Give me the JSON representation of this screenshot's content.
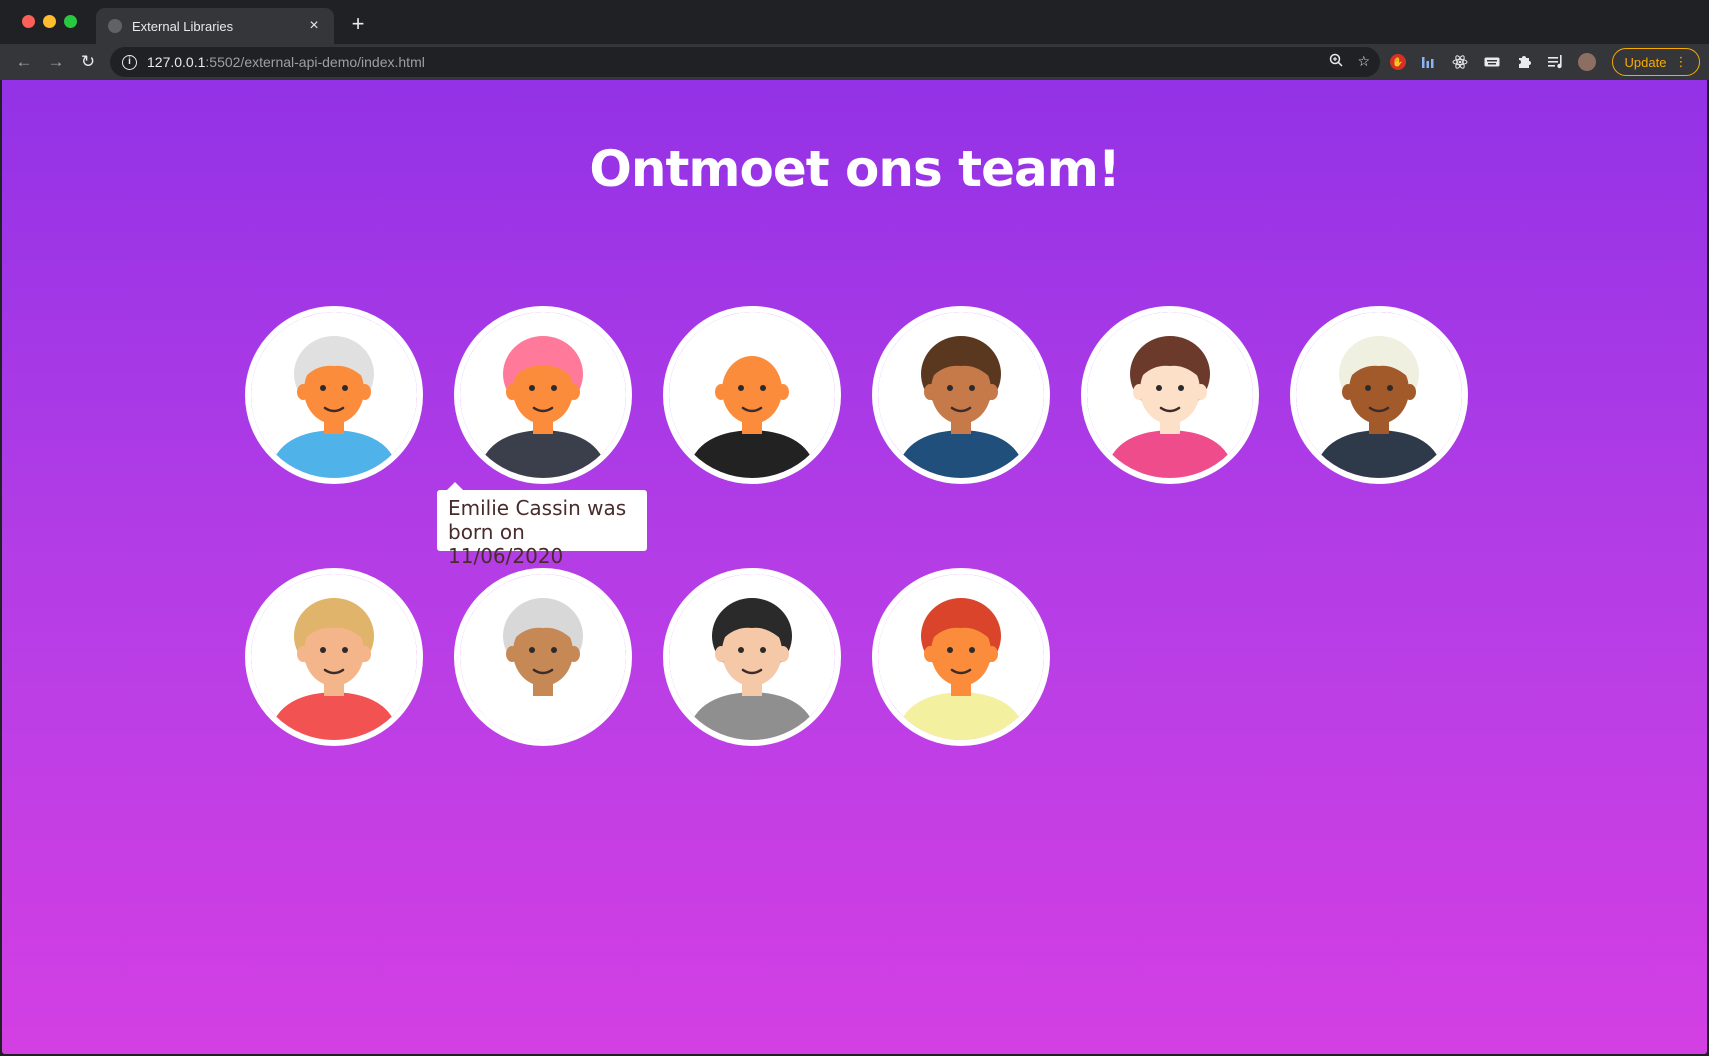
{
  "browser": {
    "tab_title": "External Libraries",
    "tab_close": "×",
    "new_tab": "+",
    "url_host": "127.0.0.1",
    "url_rest": ":5502/external-api-demo/index.html",
    "update_label": "Update",
    "update_menu": "⋮"
  },
  "page": {
    "title": "Ontmoet ons team!",
    "tooltip": "Emilie Cassin was born on 11/06/2020"
  },
  "team": [
    {
      "skin": "#fb8c3c",
      "hair": "#e0e0e0",
      "shirt": "#4fb3ea",
      "icon": "avatar-icon"
    },
    {
      "skin": "#fb8c3c",
      "hair": "#ff7a9a",
      "shirt": "#3b3f4c",
      "icon": "avatar-icon"
    },
    {
      "skin": "#fb8c3c",
      "hair": "none",
      "shirt": "#222222",
      "icon": "avatar-icon"
    },
    {
      "skin": "#c67a4a",
      "hair": "#5a3820",
      "shirt": "#1f4f7a",
      "icon": "avatar-icon"
    },
    {
      "skin": "#fde0c8",
      "hair": "#6b3a2a",
      "shirt": "#ef4c8c",
      "icon": "avatar-icon"
    },
    {
      "skin": "#a35a2a",
      "hair": "#f0f0e0",
      "shirt": "#2e3a4a",
      "icon": "avatar-icon"
    },
    {
      "skin": "#f5b58a",
      "hair": "#e0b46a",
      "shirt": "#f25252",
      "icon": "avatar-icon"
    },
    {
      "skin": "#c68855",
      "hair": "#d8d8d8",
      "shirt": "#ffffff",
      "icon": "avatar-icon"
    },
    {
      "skin": "#f5c8a8",
      "hair": "#2a2a2a",
      "shirt": "#8f8f8f",
      "icon": "avatar-icon"
    },
    {
      "skin": "#fb8c3c",
      "hair": "#d9442a",
      "shirt": "#f3f0a0",
      "icon": "avatar-icon"
    }
  ]
}
